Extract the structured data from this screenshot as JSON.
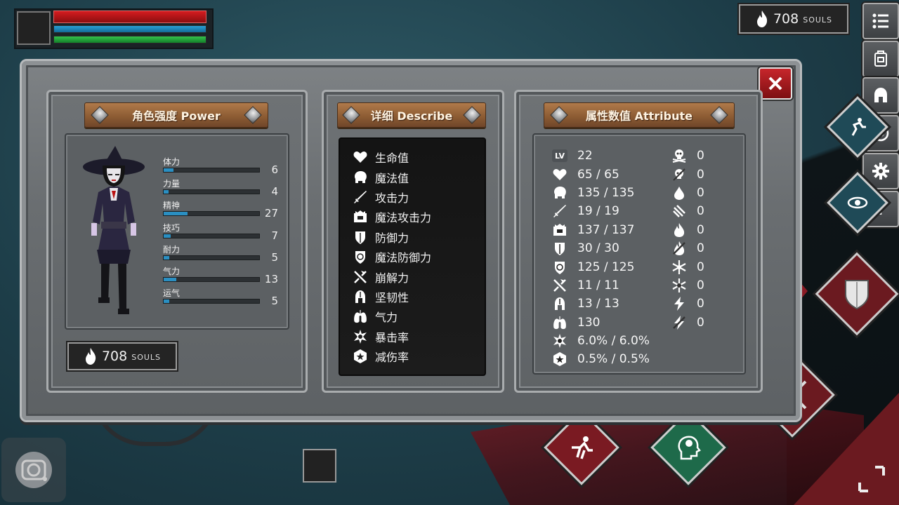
{
  "hud": {
    "souls": "708",
    "souls_unit": "SOULS"
  },
  "power_panel": {
    "title": "角色强度 Power",
    "stats": [
      {
        "label": "体力",
        "value": "6",
        "fill": 0.1
      },
      {
        "label": "力量",
        "value": "4",
        "fill": 0.05
      },
      {
        "label": "精神",
        "value": "27",
        "fill": 0.25
      },
      {
        "label": "技巧",
        "value": "7",
        "fill": 0.07
      },
      {
        "label": "耐力",
        "value": "5",
        "fill": 0.06
      },
      {
        "label": "气力",
        "value": "13",
        "fill": 0.13
      },
      {
        "label": "运气",
        "value": "5",
        "fill": 0.06
      }
    ],
    "souls": "708",
    "souls_unit": "SOULS"
  },
  "describe_panel": {
    "title": "详细 Describe",
    "items": [
      {
        "icon": "heart-icon",
        "label": "生命值"
      },
      {
        "icon": "brain-icon",
        "label": "魔法值"
      },
      {
        "icon": "sword-icon",
        "label": "攻击力"
      },
      {
        "icon": "spellbook-icon",
        "label": "魔法攻击力"
      },
      {
        "icon": "shield-icon",
        "label": "防御力"
      },
      {
        "icon": "magic-shield-icon",
        "label": "魔法防御力"
      },
      {
        "icon": "break-icon",
        "label": "崩解力"
      },
      {
        "icon": "helmet-icon",
        "label": "坚韧性"
      },
      {
        "icon": "lungs-icon",
        "label": "气力"
      },
      {
        "icon": "critical-star-icon",
        "label": "暴击率"
      },
      {
        "icon": "damage-reduction-icon",
        "label": "减伤率"
      }
    ]
  },
  "attribute_panel": {
    "title": "属性数值 Attribute",
    "level_badge": "LV",
    "left": [
      "22",
      "65 / 65",
      "135 / 135",
      "19 / 19",
      "137 / 137",
      "30 / 30",
      "125 / 125",
      "11 / 11",
      "13 / 13",
      "130",
      "6.0% / 6.0%",
      "0.5% / 0.5%"
    ],
    "right": [
      {
        "icon": "poison-skull-icon",
        "value": "0"
      },
      {
        "icon": "curse-skull-icon",
        "value": "0"
      },
      {
        "icon": "bleed-drop-icon",
        "value": "0"
      },
      {
        "icon": "slash-resist-icon",
        "value": "0"
      },
      {
        "icon": "fire-icon",
        "value": "0"
      },
      {
        "icon": "fire-resist-icon",
        "value": "0"
      },
      {
        "icon": "frost-icon",
        "value": "0"
      },
      {
        "icon": "frost-resist-icon",
        "value": "0"
      },
      {
        "icon": "lightning-icon",
        "value": "0"
      },
      {
        "icon": "lightning-resist-icon",
        "value": "0"
      }
    ]
  }
}
